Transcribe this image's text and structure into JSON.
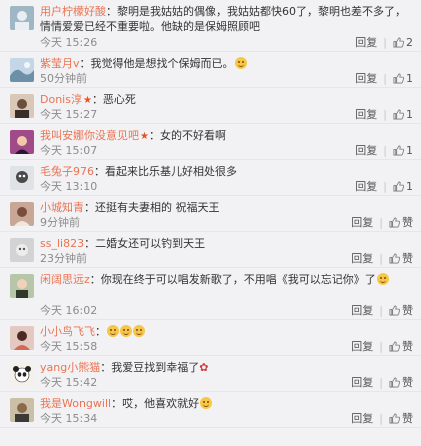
{
  "labels": {
    "reply": "回复",
    "like_default": "赞"
  },
  "comments": [
    {
      "user": "用户柠檬好酸",
      "text": "：黎明是我姑姑的偶像，我姑姑都快60了，黎明也差不多了，情情爱爱已经不重要啦。他缺的是保姆照顾吧",
      "time": "今天 15:26",
      "likes": "2"
    },
    {
      "user": "紫莹月v",
      "text": "：我觉得他是想找个保姆而已。",
      "time": "50分钟前",
      "likes": "1"
    },
    {
      "user": "Donis淳",
      "text": "：恶心死",
      "time": "今天 15:27",
      "likes": "1"
    },
    {
      "user": "我叫安娜你没意见吧",
      "text": "：女的不好看啊",
      "time": "今天 15:07",
      "likes": "1"
    },
    {
      "user": "毛兔子976",
      "text": "：看起来比乐基儿好相处很多",
      "time": "今天 13:10",
      "likes": "1"
    },
    {
      "user": "小城知青",
      "text": "：还挺有夫妻相的 祝福天王",
      "time": "9分钟前",
      "likes": "赞"
    },
    {
      "user": "ss_li823",
      "text": "：二婚女还可以钓到天王",
      "time": "23分钟前",
      "likes": "赞"
    },
    {
      "user": "闲阔思远z",
      "text": "：你现在终于可以唱发新歌了，不用唱《我可以忘记你》了",
      "time": "今天 16:02",
      "likes": "赞"
    },
    {
      "user": "小小鸟飞飞",
      "text": "：",
      "time": "今天 15:58",
      "likes": "赞"
    },
    {
      "user": "yang小熊猫",
      "text": "：我爱豆找到幸福了",
      "time": "今天 15:42",
      "likes": "赞"
    },
    {
      "user": "我是Wongwill",
      "text": "：哎，他喜欢就好",
      "time": "今天 15:34",
      "likes": "赞"
    }
  ]
}
